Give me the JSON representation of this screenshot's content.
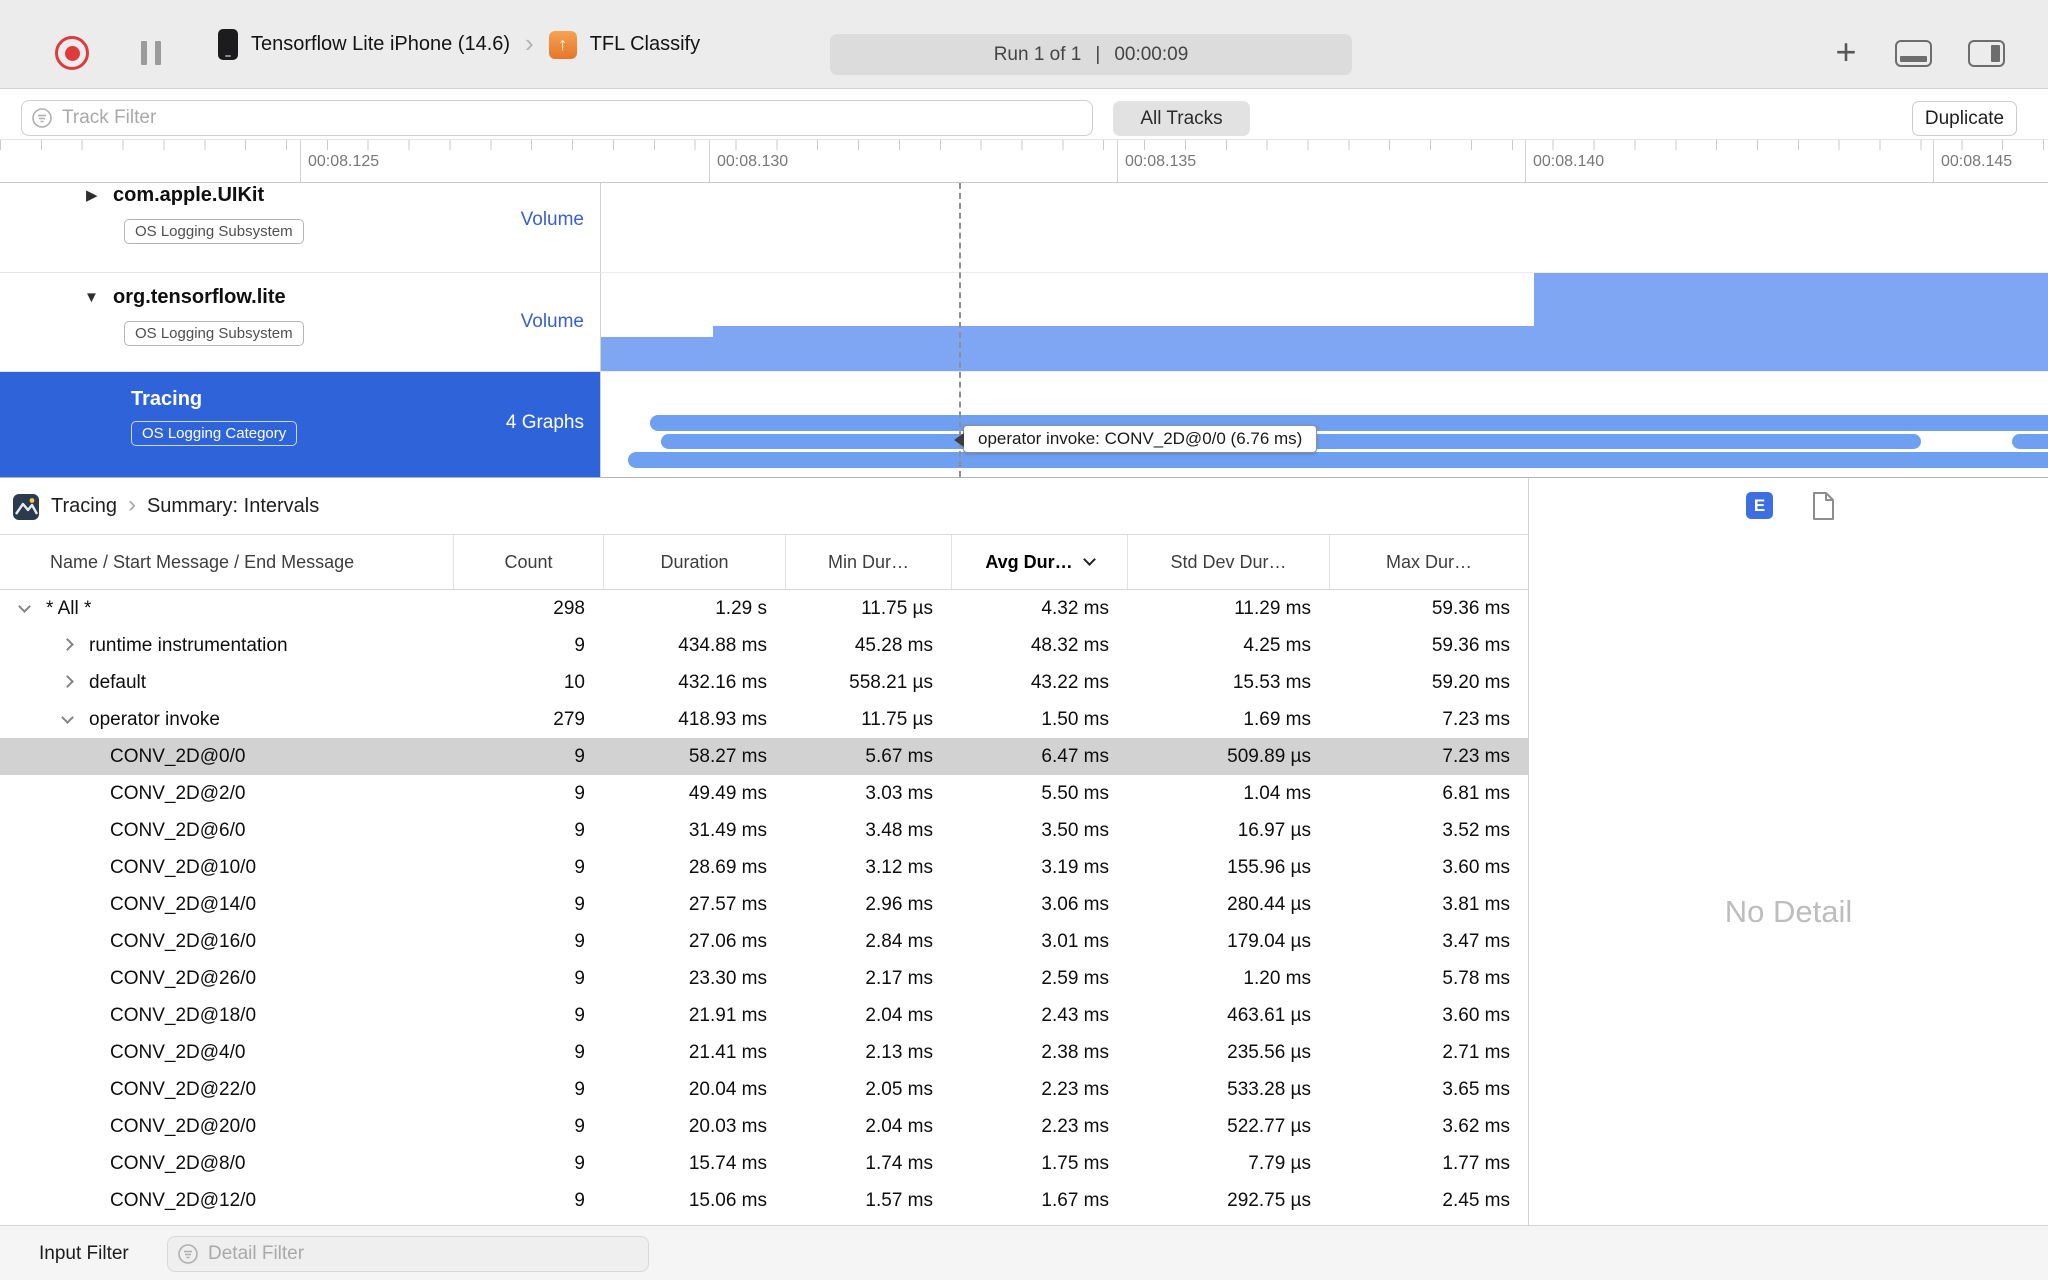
{
  "toolbar": {
    "device": "Tensorflow Lite iPhone (14.6)",
    "target": "TFL Classify",
    "run_label": "Run 1 of 1",
    "divider": "|",
    "run_time": "00:00:09"
  },
  "icons": {
    "breadcrumb_chevron": "›",
    "add": "+",
    "app_arrow": "↑",
    "collapsed_triangle": "▶",
    "expanded_triangle": "▼"
  },
  "filter_bar": {
    "track_filter_placeholder": "Track Filter",
    "all_tracks_label": "All Tracks",
    "duplicate_label": "Duplicate"
  },
  "ruler": {
    "labels": [
      "00:08.125",
      "00:08.130",
      "00:08.135",
      "00:08.140",
      "00:08.145"
    ]
  },
  "tracks": [
    {
      "name": "com.apple.UIKit",
      "badge": "OS Logging Subsystem",
      "meta": "Volume",
      "disclosure": "collapsed",
      "selected": false
    },
    {
      "name": "org.tensorflow.lite",
      "badge": "OS Logging Subsystem",
      "meta": "Volume",
      "disclosure": "expanded",
      "selected": false
    },
    {
      "name": "Tracing",
      "badge": "OS Logging Category",
      "meta": "4 Graphs",
      "disclosure": "none",
      "selected": true
    }
  ],
  "tooltip": {
    "text": "operator invoke: CONV_2D@0/0 (6.76 ms)"
  },
  "detail": {
    "breadcrumb_root": "Tracing",
    "breadcrumb_page": "Summary: Intervals",
    "e_button": "E",
    "no_detail": "No Detail",
    "input_filter_label": "Input Filter",
    "detail_filter_placeholder": "Detail Filter"
  },
  "table": {
    "columns": [
      "Name / Start Message / End Message",
      "Count",
      "Duration",
      "Min Dur…",
      "Avg Dur…",
      "Std Dev Dur…",
      "Max Dur…"
    ],
    "sort_column": "Avg Dur…",
    "rows": [
      {
        "name": "* All *",
        "level": 0,
        "disclosure": "expanded",
        "selected": false,
        "count": "298",
        "duration": "1.29 s",
        "min": "11.75 µs",
        "avg": "4.32 ms",
        "std": "11.29 ms",
        "max": "59.36 ms"
      },
      {
        "name": "runtime instrumentation",
        "level": 1,
        "disclosure": "collapsed",
        "selected": false,
        "count": "9",
        "duration": "434.88 ms",
        "min": "45.28 ms",
        "avg": "48.32 ms",
        "std": "4.25 ms",
        "max": "59.36 ms"
      },
      {
        "name": "default",
        "level": 1,
        "disclosure": "collapsed",
        "selected": false,
        "count": "10",
        "duration": "432.16 ms",
        "min": "558.21 µs",
        "avg": "43.22 ms",
        "std": "15.53 ms",
        "max": "59.20 ms"
      },
      {
        "name": "operator invoke",
        "level": 1,
        "disclosure": "expanded",
        "selected": false,
        "count": "279",
        "duration": "418.93 ms",
        "min": "11.75 µs",
        "avg": "1.50 ms",
        "std": "1.69 ms",
        "max": "7.23 ms"
      },
      {
        "name": "CONV_2D@0/0",
        "level": 2,
        "disclosure": null,
        "selected": true,
        "count": "9",
        "duration": "58.27 ms",
        "min": "5.67 ms",
        "avg": "6.47 ms",
        "std": "509.89 µs",
        "max": "7.23 ms"
      },
      {
        "name": "CONV_2D@2/0",
        "level": 2,
        "disclosure": null,
        "selected": false,
        "count": "9",
        "duration": "49.49 ms",
        "min": "3.03 ms",
        "avg": "5.50 ms",
        "std": "1.04 ms",
        "max": "6.81 ms"
      },
      {
        "name": "CONV_2D@6/0",
        "level": 2,
        "disclosure": null,
        "selected": false,
        "count": "9",
        "duration": "31.49 ms",
        "min": "3.48 ms",
        "avg": "3.50 ms",
        "std": "16.97 µs",
        "max": "3.52 ms"
      },
      {
        "name": "CONV_2D@10/0",
        "level": 2,
        "disclosure": null,
        "selected": false,
        "count": "9",
        "duration": "28.69 ms",
        "min": "3.12 ms",
        "avg": "3.19 ms",
        "std": "155.96 µs",
        "max": "3.60 ms"
      },
      {
        "name": "CONV_2D@14/0",
        "level": 2,
        "disclosure": null,
        "selected": false,
        "count": "9",
        "duration": "27.57 ms",
        "min": "2.96 ms",
        "avg": "3.06 ms",
        "std": "280.44 µs",
        "max": "3.81 ms"
      },
      {
        "name": "CONV_2D@16/0",
        "level": 2,
        "disclosure": null,
        "selected": false,
        "count": "9",
        "duration": "27.06 ms",
        "min": "2.84 ms",
        "avg": "3.01 ms",
        "std": "179.04 µs",
        "max": "3.47 ms"
      },
      {
        "name": "CONV_2D@26/0",
        "level": 2,
        "disclosure": null,
        "selected": false,
        "count": "9",
        "duration": "23.30 ms",
        "min": "2.17 ms",
        "avg": "2.59 ms",
        "std": "1.20 ms",
        "max": "5.78 ms"
      },
      {
        "name": "CONV_2D@18/0",
        "level": 2,
        "disclosure": null,
        "selected": false,
        "count": "9",
        "duration": "21.91 ms",
        "min": "2.04 ms",
        "avg": "2.43 ms",
        "std": "463.61 µs",
        "max": "3.60 ms"
      },
      {
        "name": "CONV_2D@4/0",
        "level": 2,
        "disclosure": null,
        "selected": false,
        "count": "9",
        "duration": "21.41 ms",
        "min": "2.13 ms",
        "avg": "2.38 ms",
        "std": "235.56 µs",
        "max": "2.71 ms"
      },
      {
        "name": "CONV_2D@22/0",
        "level": 2,
        "disclosure": null,
        "selected": false,
        "count": "9",
        "duration": "20.04 ms",
        "min": "2.05 ms",
        "avg": "2.23 ms",
        "std": "533.28 µs",
        "max": "3.65 ms"
      },
      {
        "name": "CONV_2D@20/0",
        "level": 2,
        "disclosure": null,
        "selected": false,
        "count": "9",
        "duration": "20.03 ms",
        "min": "2.04 ms",
        "avg": "2.23 ms",
        "std": "522.77 µs",
        "max": "3.62 ms"
      },
      {
        "name": "CONV_2D@8/0",
        "level": 2,
        "disclosure": null,
        "selected": false,
        "count": "9",
        "duration": "15.74 ms",
        "min": "1.74 ms",
        "avg": "1.75 ms",
        "std": "7.79 µs",
        "max": "1.77 ms"
      },
      {
        "name": "CONV_2D@12/0",
        "level": 2,
        "disclosure": null,
        "selected": false,
        "count": "9",
        "duration": "15.06 ms",
        "min": "1.57 ms",
        "avg": "1.67 ms",
        "std": "292.75 µs",
        "max": "2.45 ms"
      }
    ]
  }
}
